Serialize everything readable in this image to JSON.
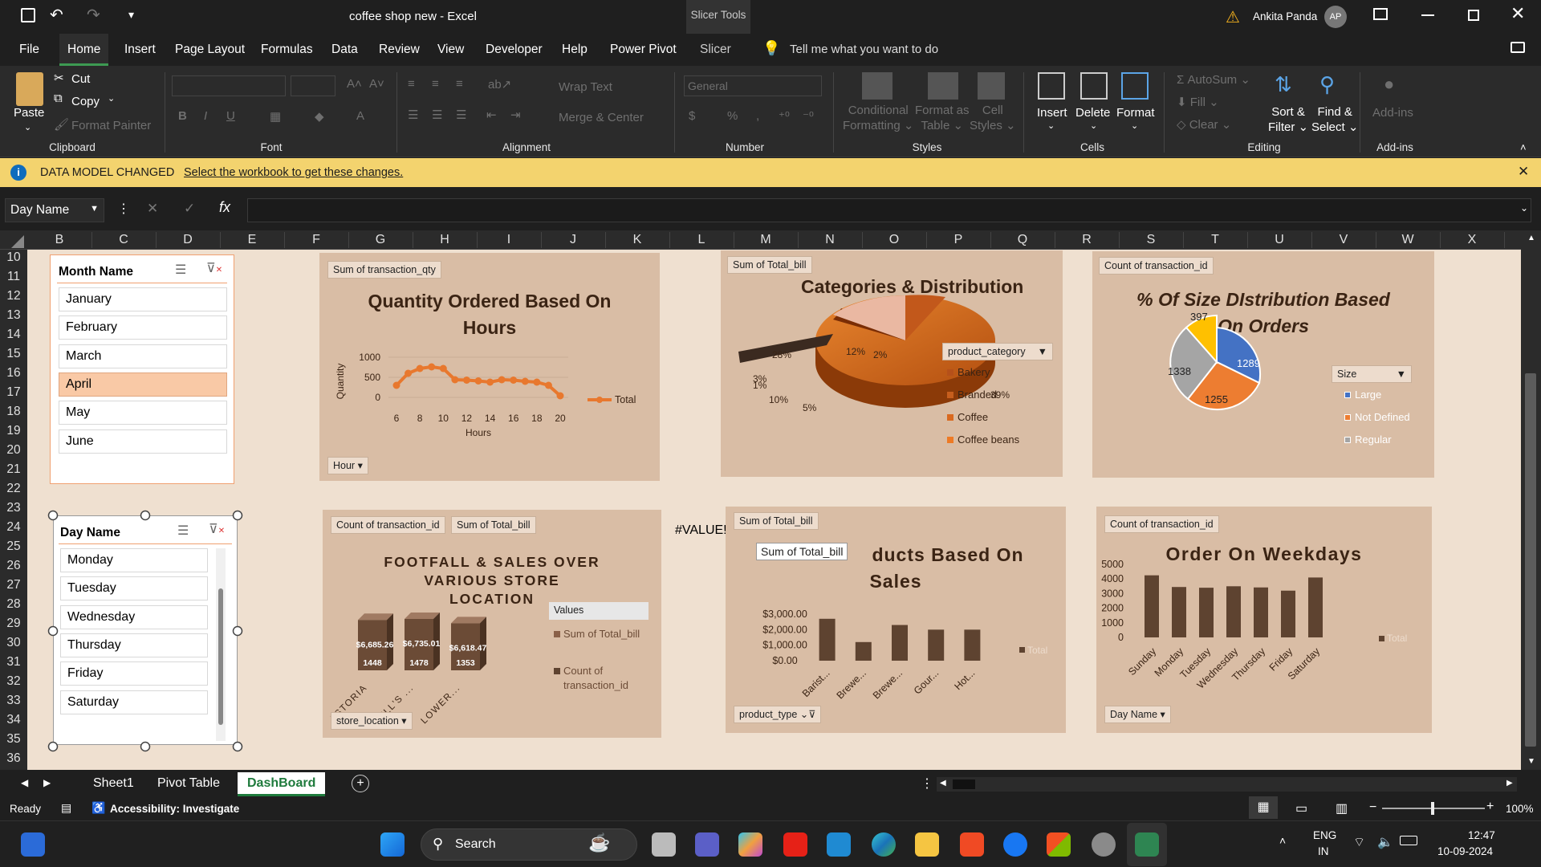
{
  "window": {
    "title": "coffee shop new  -  Excel",
    "context_tab": "Slicer Tools",
    "user": "Ankita Panda",
    "avatar": "AP"
  },
  "menu": [
    "File",
    "Home",
    "Insert",
    "Page Layout",
    "Formulas",
    "Data",
    "Review",
    "View",
    "Developer",
    "Help",
    "Power Pivot",
    "Slicer"
  ],
  "search_placeholder": "Tell me what you want to do",
  "ribbon": {
    "clipboard": {
      "paste": "Paste",
      "cut": "Cut",
      "copy": "Copy",
      "format_painter": "Format Painter",
      "label": "Clipboard"
    },
    "font": {
      "label": "Font"
    },
    "alignment": {
      "wrap": "Wrap Text",
      "merge": "Merge & Center",
      "label": "Alignment"
    },
    "number": {
      "format": "General",
      "label": "Number"
    },
    "styles": {
      "cond1": "Conditional",
      "cond2": "Formatting",
      "fmt1": "Format as",
      "fmt2": "Table",
      "cell1": "Cell",
      "cell2": "Styles",
      "label": "Styles"
    },
    "cells": {
      "insert": "Insert",
      "delete": "Delete",
      "format": "Format",
      "label": "Cells"
    },
    "editing": {
      "autosum": "AutoSum",
      "fill": "Fill",
      "clear": "Clear",
      "sort1": "Sort &",
      "sort2": "Filter",
      "find1": "Find &",
      "find2": "Select",
      "label": "Editing"
    },
    "addins": {
      "btn": "Add-ins",
      "label": "Add-ins"
    }
  },
  "banner": {
    "title": "DATA MODEL CHANGED",
    "link": "Select the workbook to get these changes."
  },
  "namebox": "Day Name",
  "columns": [
    "B",
    "C",
    "D",
    "E",
    "F",
    "G",
    "H",
    "I",
    "J",
    "K",
    "L",
    "M",
    "N",
    "O",
    "P",
    "Q",
    "R",
    "S",
    "T",
    "U",
    "V",
    "W",
    "X"
  ],
  "rows": [
    "10",
    "11",
    "12",
    "13",
    "14",
    "15",
    "16",
    "17",
    "18",
    "19",
    "20",
    "21",
    "22",
    "23",
    "24",
    "25",
    "26",
    "27",
    "28",
    "29",
    "30",
    "31",
    "32",
    "33",
    "34",
    "35",
    "36"
  ],
  "month_slicer": {
    "title": "Month Name",
    "items": [
      "January",
      "February",
      "March",
      "April",
      "May",
      "June"
    ],
    "selected": "April"
  },
  "day_slicer": {
    "title": "Day Name",
    "items": [
      "Monday",
      "Tuesday",
      "Wednesday",
      "Thursday",
      "Friday",
      "Saturday"
    ]
  },
  "cell_error": "#VALUE!",
  "tooltip": "Sum of Total_bill",
  "chart_data": [
    {
      "type": "line",
      "tag": "Sum of transaction_qty",
      "title": "Quantity Ordered Based On Hours",
      "xlabel": "Hours",
      "ylabel": "Quantity",
      "x": [
        6,
        7,
        8,
        9,
        10,
        11,
        12,
        13,
        14,
        15,
        16,
        17,
        18,
        19,
        20
      ],
      "y_ticks": [
        "1000",
        "500",
        "0"
      ],
      "x_ticks": [
        "6",
        "8",
        "10",
        "12",
        "14",
        "16",
        "18",
        "20"
      ],
      "ylim": [
        0,
        1000
      ],
      "series": [
        {
          "name": "Total",
          "values": [
            300,
            600,
            720,
            760,
            720,
            440,
            430,
            410,
            380,
            440,
            430,
            400,
            380,
            300,
            40
          ]
        }
      ],
      "field_button": "Hour"
    },
    {
      "type": "pie",
      "tag": "Sum of Total_bill",
      "title": "Categories & Distribution",
      "legend_title": "product_category",
      "categories": [
        "Bakery",
        "Branded",
        "Coffee",
        "Coffee beans"
      ],
      "labels": [
        "39%",
        "28%",
        "12%",
        "2%",
        "1%",
        "3%",
        "10%",
        "5%"
      ]
    },
    {
      "type": "pie",
      "tag": "Count of transaction_id",
      "title": "% Of Size DIstribution Based On Orders",
      "legend_title": "Size",
      "categories": [
        "Large",
        "Not Defined",
        "Regular"
      ],
      "values": [
        1289,
        1255,
        1338,
        397
      ]
    },
    {
      "type": "bar",
      "tags": [
        "Count of transaction_id",
        "Sum of Total_bill"
      ],
      "title": "FOOTFALL & SALES OVER VARIOUS STORE LOCATION",
      "categories": [
        "ASTORIA",
        "HELL'S...",
        "LOWER..."
      ],
      "x_ticks": [
        "ASTORIA",
        "HELL'S ...",
        "LOWER..."
      ],
      "series": [
        {
          "name": "Sum of Total_bill",
          "values": [
            6685.26,
            6735.01,
            6618.47
          ],
          "labels": [
            "$6,685.26",
            "$6,735.01",
            "$6,618.47"
          ]
        },
        {
          "name": "Count of transaction_id",
          "values": [
            1448,
            1478,
            1353
          ],
          "labels": [
            "1448",
            "1478",
            "1353"
          ]
        }
      ],
      "legend_title": "Values",
      "legend": [
        "Sum of Total_bill",
        "Count of transaction_id"
      ],
      "legend_display": [
        [
          "Sum of Total_bill"
        ],
        [
          "Count of",
          "transaction_id"
        ]
      ],
      "field_button": "store_location"
    },
    {
      "type": "bar",
      "tag": "Sum of Total_bill",
      "title": "Top Products Based On Sales",
      "visible_title_1": "ducts Based On",
      "visible_title_2": "Sales",
      "categories": [
        "Barist...",
        "Brewe...",
        "Brewe...",
        "Gour...",
        "Hot..."
      ],
      "values": [
        2700,
        1200,
        2300,
        2000,
        2000
      ],
      "y_ticks": [
        "$3,000.00",
        "$2,000.00",
        "$1,000.00",
        "$0.00"
      ],
      "ylim": [
        0,
        3000
      ],
      "legend": "Total",
      "field_button": "product_type"
    },
    {
      "type": "bar",
      "tag": "Count of transaction_id",
      "title": "Order On Weekdays",
      "categories": [
        "Sunday",
        "Monday",
        "Tuesday",
        "Wednesday",
        "Thursday",
        "Friday",
        "Saturday"
      ],
      "values": [
        4250,
        3450,
        3400,
        3500,
        3420,
        3200,
        4100
      ],
      "y_ticks": [
        "5000",
        "4000",
        "3000",
        "2000",
        "1000",
        "0"
      ],
      "ylim": [
        0,
        5000
      ],
      "legend": "Total",
      "field_button": "Day Name"
    }
  ],
  "sheets": [
    "Sheet1",
    "Pivot Table",
    "DashBoard"
  ],
  "active_sheet": "DashBoard",
  "status": {
    "ready": "Ready",
    "accessibility": "Accessibility: Investigate",
    "zoom": "100%"
  },
  "taskbar": {
    "search": "Search",
    "lang1": "ENG",
    "lang2": "IN",
    "time": "12:47",
    "date": "10-09-2024"
  },
  "colors": {
    "panel": "#d9bda5",
    "orange": "#e8782e",
    "bar_brown": "#5e4330",
    "sheet_bg": "#efe0d0",
    "accent_green": "#3d9a52"
  }
}
